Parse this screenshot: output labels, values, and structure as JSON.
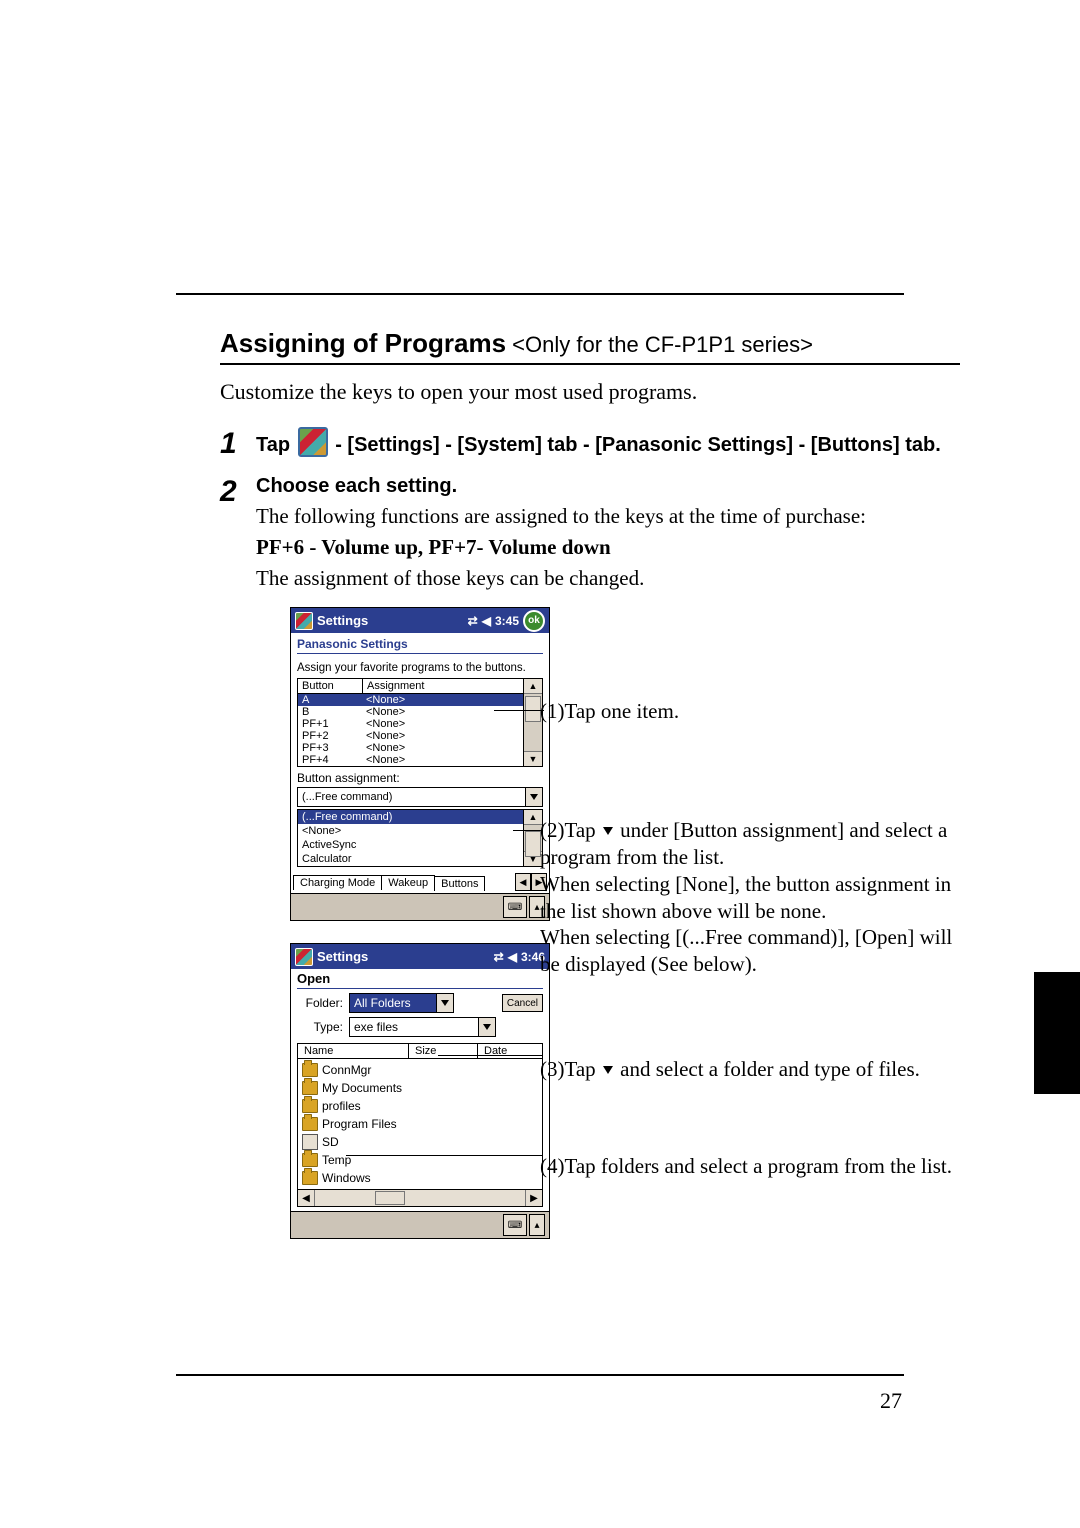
{
  "page_number": "27",
  "section": {
    "title_bold": "Assigning of Programs",
    "title_rest": " <Only for the CF-P1P1 series>",
    "intro": "Customize the keys to open your most used programs."
  },
  "steps": {
    "s1": {
      "num": "1",
      "before": "Tap ",
      "after": " - [Settings] - [System] tab - [Panasonic Settings] - [Buttons] tab."
    },
    "s2": {
      "num": "2",
      "title": "Choose each setting.",
      "line1": "The following functions are assigned to the keys at the time of purchase:",
      "line2": "PF+6 - Volume up, PF+7- Volume down",
      "line3": "The assignment of those keys can be changed."
    }
  },
  "callouts": {
    "c1": "(1)Tap one item.",
    "c2a": "(2)Tap ",
    "c2b": " under [Button assignment] and select a program from the list.",
    "c2c": "When selecting [None], the button assignment in the list shown above will be none.",
    "c2d": "When selecting [(...Free command)], [Open] will be displayed (See below).",
    "c3a": "(3)Tap ",
    "c3b": " and select a folder and type of files.",
    "c4": "(4)Tap folders and select a program from the list."
  },
  "pocket1": {
    "title": "Settings",
    "time": "3:45",
    "subtitle": "Panasonic Settings",
    "desc": "Assign your favorite programs to the buttons.",
    "head_btn": "Button",
    "head_asg": "Assignment",
    "rows": [
      {
        "b": "A",
        "a": "<None>"
      },
      {
        "b": "B",
        "a": "<None>"
      },
      {
        "b": "PF+1",
        "a": "<None>"
      },
      {
        "b": "PF+2",
        "a": "<None>"
      },
      {
        "b": "PF+3",
        "a": "<None>"
      },
      {
        "b": "PF+4",
        "a": "<None>"
      }
    ],
    "ba_label": "Button assignment:",
    "dd_value": "(...Free command)",
    "list": [
      "(...Free command)",
      "<None>",
      "ActiveSync",
      "Calculator"
    ],
    "tabs": [
      "Charging Mode",
      "Wakeup",
      "Buttons"
    ],
    "ok": "ok"
  },
  "pocket2": {
    "title": "Settings",
    "time": "3:46",
    "open": "Open",
    "folder_label": "Folder:",
    "folder_value": "All Folders",
    "cancel": "Cancel",
    "type_label": "Type:",
    "type_value": "exe files",
    "cols": {
      "name": "Name",
      "size": "Size",
      "date": "Date"
    },
    "files": [
      {
        "icon": "folder",
        "name": "ConnMgr"
      },
      {
        "icon": "folder",
        "name": "My Documents"
      },
      {
        "icon": "folder",
        "name": "profiles"
      },
      {
        "icon": "folder",
        "name": "Program Files"
      },
      {
        "icon": "sd",
        "name": "SD"
      },
      {
        "icon": "folder",
        "name": "Temp"
      },
      {
        "icon": "folder",
        "name": "Windows"
      }
    ]
  }
}
